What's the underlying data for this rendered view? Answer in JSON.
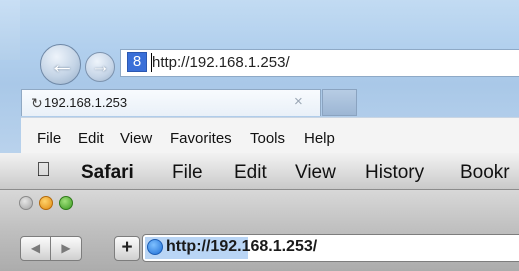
{
  "ie": {
    "url": "http://192.168.1.253/",
    "favicon_label": "8",
    "tab": {
      "label": "192.168.1.253",
      "icon": "refresh-icon",
      "close_glyph": "×"
    },
    "menu": [
      "File",
      "Edit",
      "View",
      "Favorites",
      "Tools",
      "Help"
    ],
    "colors": {
      "frame": "#b2d0ee",
      "favicon": "#3a6fd8"
    }
  },
  "safari": {
    "menu": {
      "app": "Safari",
      "items": [
        "File",
        "Edit",
        "View",
        "History",
        "Bookr"
      ]
    },
    "add_label": "+",
    "url": "http://192.168.1.253/",
    "icons": [
      "apple-icon",
      "back-icon",
      "forward-icon",
      "globe-icon"
    ],
    "colors": {
      "close": "#a3a3a3",
      "minimize": "#e08a12",
      "zoom": "#3c9a23",
      "selection": "#b9d5f5"
    }
  }
}
